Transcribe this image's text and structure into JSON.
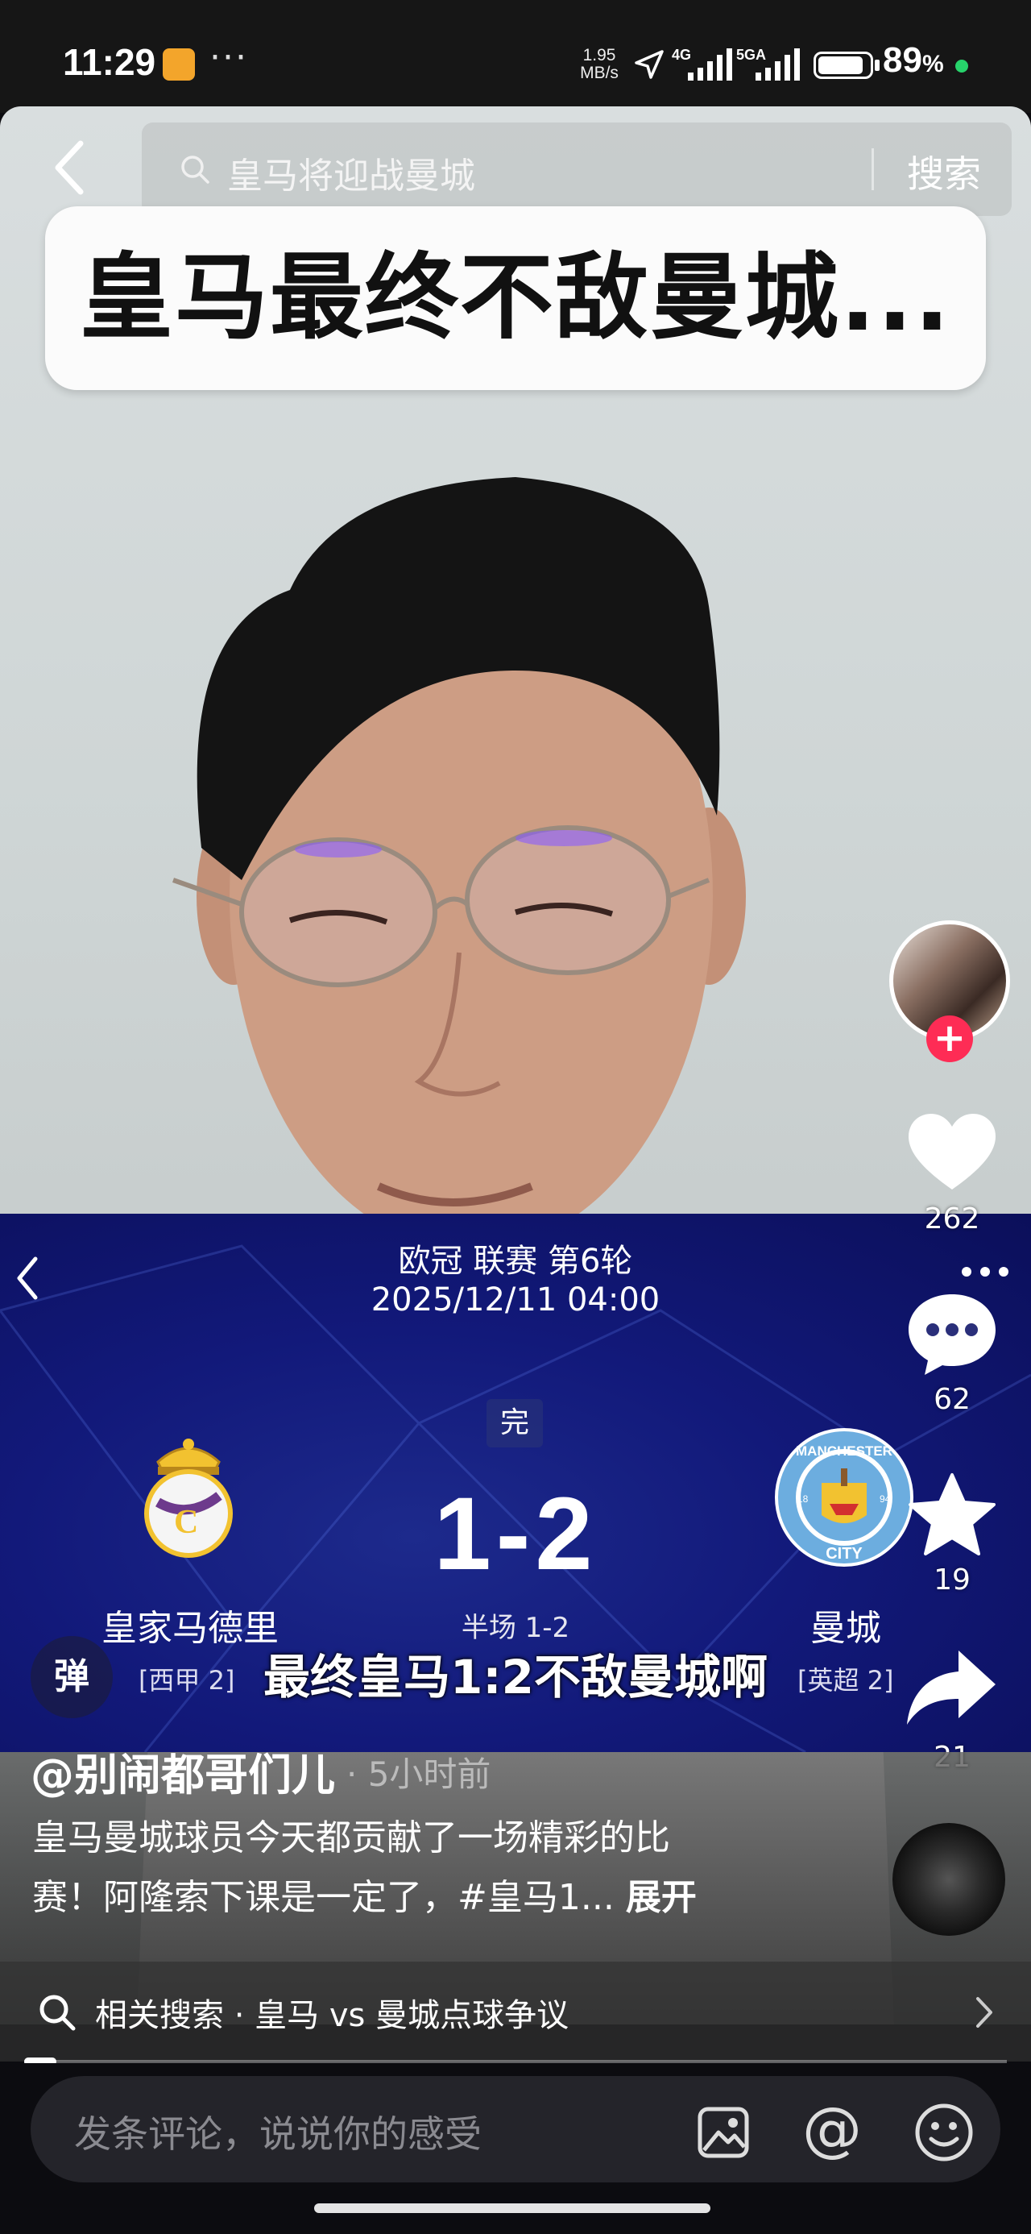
{
  "status_bar": {
    "time": "11:29",
    "more": "···",
    "net_speed_value": "1.95",
    "net_speed_unit": "MB/s",
    "signal1": "4G",
    "signal2": "5GA",
    "battery_pct": "89",
    "battery_unit": "%",
    "battery_level": 0.89
  },
  "search": {
    "query": "皇马将迎战曼城",
    "button": "搜索"
  },
  "video": {
    "headline": "皇马最终不敌曼城..."
  },
  "match": {
    "competition": "欧冠 联赛 第6轮",
    "datetime": "2025/12/11 04:00",
    "status": "完",
    "score": "1-2",
    "halftime": "半场 1-2",
    "home_team": "皇家马德里",
    "home_league": "[西甲 2]",
    "away_team": "曼城",
    "away_league": "[英超 2]",
    "away_badge_text": "MANCHESTER",
    "away_badge_city": "CITY",
    "away_badge_left": "18",
    "away_badge_right": "94"
  },
  "danmu": "弹",
  "subtitle": "最终皇马1:2不敌曼城啊",
  "rail": {
    "follow": "+",
    "likes": "262",
    "comments": "62",
    "favorites": "19",
    "shares": "21"
  },
  "post": {
    "author": "@别闹都哥们儿",
    "time": "· 5小时前",
    "desc_line1": "皇马曼城球员今天都贡献了一场精彩的比",
    "desc_line2": "赛！阿隆索下课是一定了，#皇马1...",
    "expand": "展开"
  },
  "related": {
    "text": "相关搜索 · 皇马 vs 曼城点球争议"
  },
  "comment": {
    "placeholder": "发条评论，说说你的感受",
    "at": "@"
  },
  "colors": {
    "accent_red": "#fe2c55",
    "score_panel": "#12197a",
    "battery_dot": "#27d36b"
  }
}
